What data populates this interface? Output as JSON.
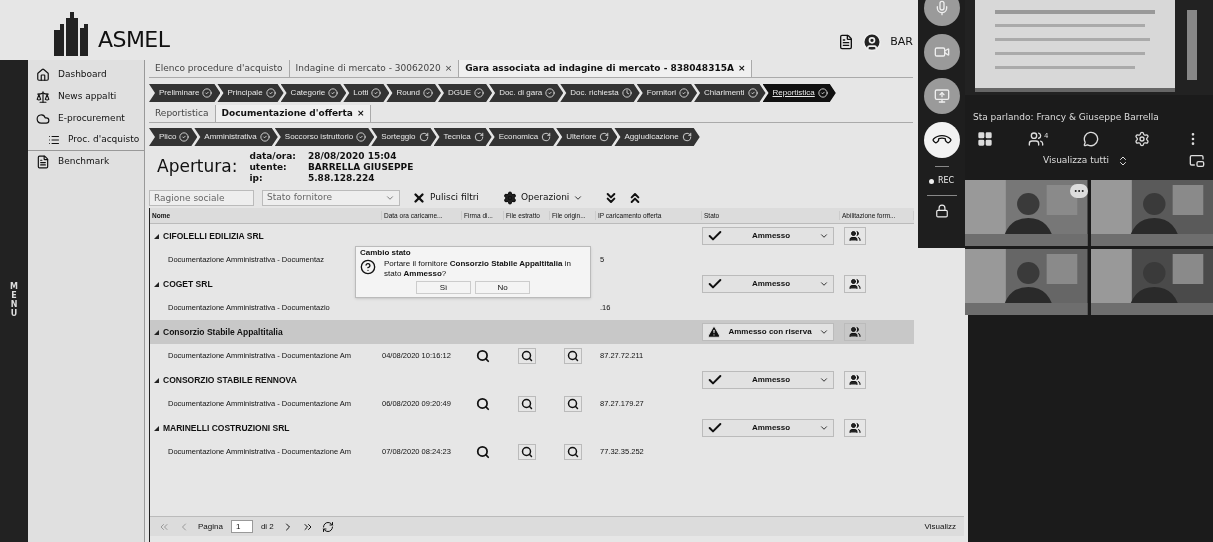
{
  "header": {
    "logo_text": "ASMEL",
    "user_text": "BAR"
  },
  "sidebar": {
    "menu_label": "MENU",
    "items": [
      {
        "label": "Dashboard"
      },
      {
        "label": "News appalti"
      },
      {
        "label": "E-procurement",
        "children": [
          {
            "label": "Proc. d'acquisto"
          }
        ]
      },
      {
        "label": "Benchmark"
      }
    ]
  },
  "tabs": [
    {
      "label": "Elenco procedure d'acquisto",
      "selected": false
    },
    {
      "label": "Indagine di mercato - 30062020",
      "selected": false,
      "close": "×"
    },
    {
      "label": "Gara associata ad indagine di mercato - 838048315A",
      "selected": true,
      "close": "×"
    }
  ],
  "steps": [
    {
      "label": "Preliminare",
      "kind": "done",
      "selected": false
    },
    {
      "label": "Principale",
      "kind": "done",
      "selected": false
    },
    {
      "label": "Categorie",
      "kind": "done",
      "selected": false
    },
    {
      "label": "Lotti",
      "kind": "done",
      "selected": false
    },
    {
      "label": "Round",
      "kind": "done",
      "selected": false
    },
    {
      "label": "DGUE",
      "kind": "done",
      "selected": false
    },
    {
      "label": "Doc. di gara",
      "kind": "done",
      "selected": false
    },
    {
      "label": "Doc. richiesta",
      "kind": "waiting",
      "selected": false
    },
    {
      "label": "Fornitori",
      "kind": "done",
      "selected": false
    },
    {
      "label": "Chiarimenti",
      "kind": "done",
      "selected": false
    },
    {
      "label": "Reportistica",
      "kind": "done",
      "selected": true
    }
  ],
  "subtabs": [
    {
      "label": "Reportistica",
      "selected": false
    },
    {
      "label": "Documentazione d'offerta",
      "selected": true,
      "close": "×"
    }
  ],
  "substeps": [
    {
      "label": "Plico",
      "kind": "done"
    },
    {
      "label": "Amministrativa",
      "kind": "done"
    },
    {
      "label": "Soccorso istruttorio",
      "kind": "done"
    },
    {
      "label": "Sorteggio",
      "kind": "pending"
    },
    {
      "label": "Tecnica",
      "kind": "pending"
    },
    {
      "label": "Economica",
      "kind": "pending"
    },
    {
      "label": "Ulteriore",
      "kind": "pending"
    },
    {
      "label": "Aggiudicazione",
      "kind": "pending"
    }
  ],
  "apertura": {
    "title": "Apertura:",
    "fields": [
      {
        "label": "data/ora:",
        "value": "28/08/2020 15:04"
      },
      {
        "label": "utente:",
        "value": "BARRELLA GIUSEPPE"
      },
      {
        "label": "ip:",
        "value": "5.88.128.224"
      }
    ]
  },
  "toolbar": {
    "name_filter": {
      "placeholder": "Ragione sociale"
    },
    "status_filter": {
      "placeholder": "Stato fornitore"
    },
    "clear_button": "Pulisci filtri",
    "operations_button": "Operazioni"
  },
  "table": {
    "columns": [
      "Nome",
      "Data ora caricame...",
      "Firma di...",
      "File estratto",
      "File origin...",
      "IP caricamento offerta",
      "Stato",
      "Abilitazione form..."
    ],
    "groups": [
      {
        "name": "CIFOLELLI EDILIZIA SRL",
        "selected": false,
        "status": "Ammesso",
        "kind": "ok",
        "doc": {
          "name": "Documentazione Amministrativa - Documentaz",
          "ip": "5"
        }
      },
      {
        "name": "COGET SRL",
        "selected": false,
        "status": "Ammesso",
        "kind": "ok",
        "doc": {
          "name": "Documentazione Amministrativa - Documentazio",
          "ip": ".16"
        }
      },
      {
        "name": "Consorzio Stabile Appaltitalia",
        "selected": true,
        "status": "Ammesso con riserva",
        "kind": "warning",
        "doc": {
          "name": "Documentazione Amministrativa - Documentazione Am",
          "date": "04/08/2020 10:16:12",
          "ip": "87.27.72.211"
        }
      },
      {
        "name": "CONSORZIO STABILE RENNOVA",
        "selected": false,
        "status": "Ammesso",
        "kind": "ok",
        "doc": {
          "name": "Documentazione Amministrativa - Documentazione Am",
          "date": "06/08/2020 09:20:49",
          "ip": "87.27.179.27"
        }
      },
      {
        "name": "MARINELLI COSTRUZIONI SRL",
        "selected": false,
        "status": "Ammesso",
        "kind": "ok",
        "doc": {
          "name": "Documentazione Amministrativa - Documentazione Am",
          "date": "07/08/2020 08:24:23",
          "ip": "77.32.35.252"
        }
      }
    ]
  },
  "dialog": {
    "title": "Cambio stato",
    "message": "Portare il fornitore **Consorzio Stabile Appaltitalia** in stato **Ammesso**?",
    "buttons": [
      "Sì",
      "No"
    ]
  },
  "pager": {
    "page_label": "Pagina",
    "page": "1",
    "total": "di 2",
    "summary": "Visualizz"
  },
  "call": {
    "rec": "REC",
    "speaking": "Sta parlando: Francy & Giuseppe Barrella",
    "participants": "4",
    "view_all": "Visualizza tutti"
  }
}
